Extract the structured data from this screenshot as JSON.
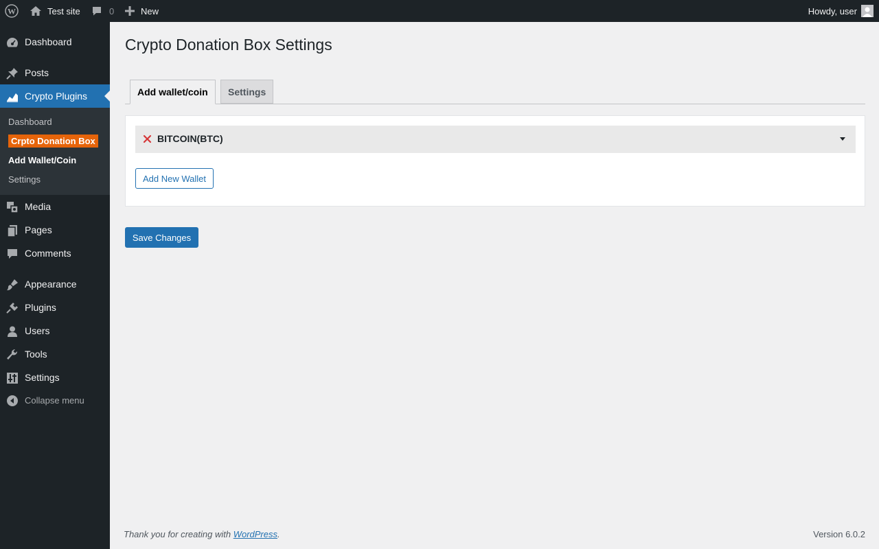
{
  "adminbar": {
    "site_name": "Test site",
    "comments_count": "0",
    "new_label": "New",
    "howdy": "Howdy, user"
  },
  "sidebar": {
    "items": [
      {
        "label": "Dashboard",
        "icon": "dashboard-icon"
      },
      {
        "label": "Posts",
        "icon": "pin-icon"
      },
      {
        "label": "Crypto Plugins",
        "icon": "chart-icon"
      },
      {
        "label": "Media",
        "icon": "media-icon"
      },
      {
        "label": "Pages",
        "icon": "pages-icon"
      },
      {
        "label": "Comments",
        "icon": "comment-icon"
      },
      {
        "label": "Appearance",
        "icon": "brush-icon"
      },
      {
        "label": "Plugins",
        "icon": "plug-icon"
      },
      {
        "label": "Users",
        "icon": "user-icon"
      },
      {
        "label": "Tools",
        "icon": "wrench-icon"
      },
      {
        "label": "Settings",
        "icon": "sliders-icon"
      }
    ],
    "submenu": {
      "dashboard": "Dashboard",
      "donation_box": "Crpto Donation Box",
      "add_wallet": " Add Wallet/Coin",
      "settings": " Settings"
    },
    "collapse_label": "Collapse menu"
  },
  "main": {
    "title": "Crypto Donation Box Settings",
    "tabs": [
      {
        "label": "Add wallet/coin",
        "active": true
      },
      {
        "label": "Settings",
        "active": false
      }
    ],
    "wallet_name": "BITCOIN(BTC)",
    "add_wallet_button": "Add New Wallet",
    "save_button": "Save Changes"
  },
  "footer": {
    "thanks_prefix": "Thank you for creating with ",
    "thanks_link": "WordPress",
    "thanks_suffix": ".",
    "version": "Version 6.0.2"
  },
  "colors": {
    "accent": "#2271b1",
    "highlight": "#e6640a",
    "remove": "#d63638"
  }
}
